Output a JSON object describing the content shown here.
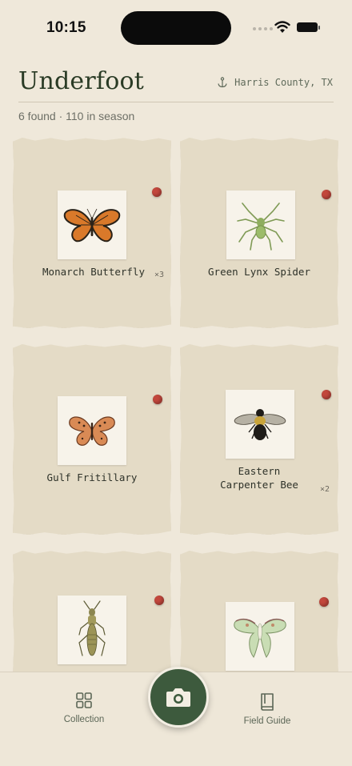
{
  "status": {
    "time": "10:15"
  },
  "header": {
    "title": "Underfoot",
    "location": "Harris County, TX",
    "summary": "6 found · 110 in season"
  },
  "cards": [
    {
      "name": "Monarch Butterfly",
      "multiplier": "×3",
      "icon": "monarch-butterfly"
    },
    {
      "name": "Green Lynx Spider",
      "multiplier": "",
      "icon": "green-lynx-spider"
    },
    {
      "name": "Gulf Fritillary",
      "multiplier": "",
      "icon": "gulf-fritillary"
    },
    {
      "name": "Eastern Carpenter Bee",
      "name_line1": "Eastern",
      "name_line2": "Carpenter Bee",
      "multiplier": "×2",
      "icon": "carpenter-bee"
    },
    {
      "name": "",
      "multiplier": "",
      "icon": "grasshopper"
    },
    {
      "name": "",
      "multiplier": "",
      "icon": "luna-moth"
    }
  ],
  "tabs": {
    "collection": "Collection",
    "field_guide": "Field Guide"
  },
  "colors": {
    "background": "#efe8da",
    "card": "#e4dbc6",
    "accent_green": "#3d5a3d",
    "pin_red": "#c2473c"
  }
}
